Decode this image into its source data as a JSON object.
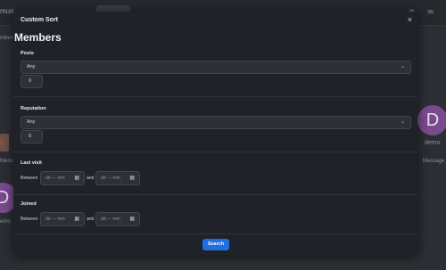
{
  "background": {
    "brand": "mun",
    "menu_text": "mbers",
    "icons": "⚙ ✉",
    "left_label": "Message",
    "left_red": "n",
    "right_name": "demo",
    "right_message": "Message",
    "left_name": "emo",
    "avatar_letter": "D"
  },
  "modal": {
    "title": "Custom Sort",
    "close_label": "×",
    "heading": "Members",
    "posts": {
      "label": "Posts",
      "select_value": "Any",
      "number_value": "0"
    },
    "reputation": {
      "label": "Reputation",
      "select_value": "Any",
      "number_value": "0"
    },
    "last_visit": {
      "label": "Last visit",
      "between": "Between",
      "and": "and",
      "from_placeholder": "dd --- mm",
      "to_placeholder": "dd --- mm"
    },
    "joined": {
      "label": "Joined",
      "between": "Between",
      "and": "and",
      "from_placeholder": "dd --- mm",
      "to_placeholder": "dd --- mm"
    },
    "search_label": "Search"
  },
  "icons": {
    "chevron": "chevron-down-icon",
    "calendar": "calendar-icon",
    "close": "close-icon"
  }
}
